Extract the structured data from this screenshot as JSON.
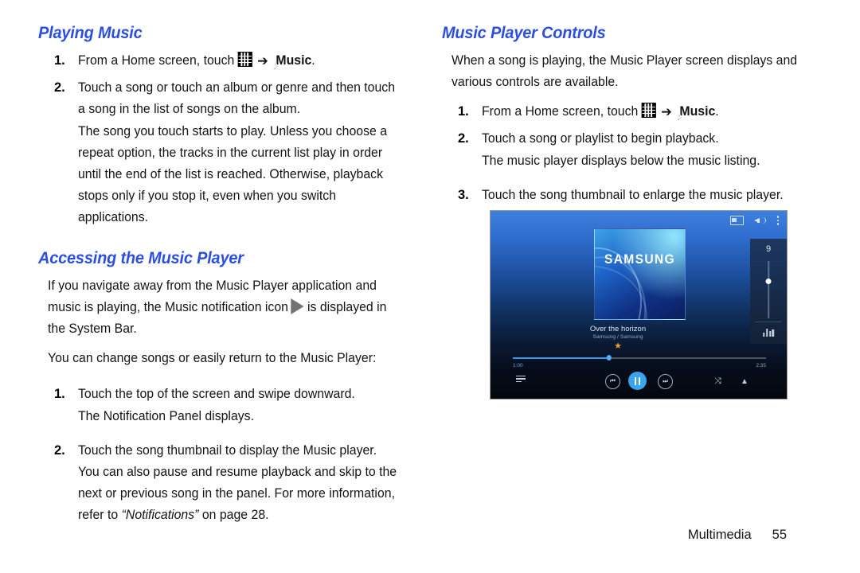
{
  "page": {
    "footer_label": "Multimedia",
    "footer_page_number": "55",
    "heading_color": "#2c4fe2"
  },
  "left_column": {
    "heading_playing_music": "Playing Music",
    "step1": {
      "number": "1.",
      "text_before_icons": "From a Home screen, touch",
      "apps_icon_name": "apps-grid-icon",
      "arrow": "➔",
      "music_icon_name": "music-app-icon",
      "music_label": "Music",
      "period": "."
    },
    "step2": {
      "number": "2.",
      "text": "Touch a song or touch an album or genre and then touch a song in the list of songs on the album.",
      "note": "The song you touch starts to play. Unless you choose a repeat option, the tracks in the current list play in order until the end of the list is reached. Otherwise, playback stops only if you stop it, even when you switch applications."
    },
    "heading_accessing": "Accessing the Music Player",
    "paragraph_notification_a": "If you navigate away from the Music Player application and music is playing, the Music notification icon",
    "notification_icon_name": "play-triangle-icon",
    "paragraph_notification_b": "is displayed in the System Bar.",
    "paragraph_change_songs": "You can change songs or easily return to the Music Player:",
    "step_a": {
      "number": "1.",
      "text": "Touch the top of the screen and swipe downward.",
      "note": "The Notification Panel displays."
    },
    "step_b": {
      "number": "2.",
      "text_part1": "Touch the song thumbnail to display the Music player. You can also pause and resume playback and skip to the next or previous song in the panel. For more information, refer to",
      "italic_ref": "“Notifications”",
      "text_part2": "on page 28."
    }
  },
  "right_column": {
    "heading_music_player_controls": "Music Player Controls",
    "intro": "When a song is playing, the Music Player screen displays and various controls are available.",
    "step1": {
      "number": "1.",
      "text_before_icons": "From a Home screen, touch",
      "apps_icon_name": "apps-grid-icon",
      "arrow": "➔",
      "music_icon_name": "music-app-icon",
      "music_label": "Music",
      "period": "."
    },
    "step2": {
      "number": "2.",
      "text": "Touch a song or playlist to begin playback.",
      "note": "The music player displays below the music listing."
    },
    "step3": {
      "number": "3.",
      "text": "Touch the song thumbnail to enlarge the music player."
    }
  },
  "player_screenshot": {
    "album_art_brand": "SAMSUNG",
    "track_title": "Over the horizon",
    "track_artist": "Samsung / Samsung",
    "favorite_star": "★",
    "time_current": "1:00",
    "time_total": "2:35",
    "volume_level": "9",
    "shuffle_glyph": "⤨",
    "repeat_glyph": "▲",
    "prev_glyph": "⏮",
    "next_glyph": "⏭",
    "icons": {
      "cast": "screen-mirror-icon",
      "speaker": "volume-icon",
      "overflow": "more-options-icon",
      "queue": "playlist-queue-icon",
      "equalizer": "equalizer-icon"
    }
  }
}
